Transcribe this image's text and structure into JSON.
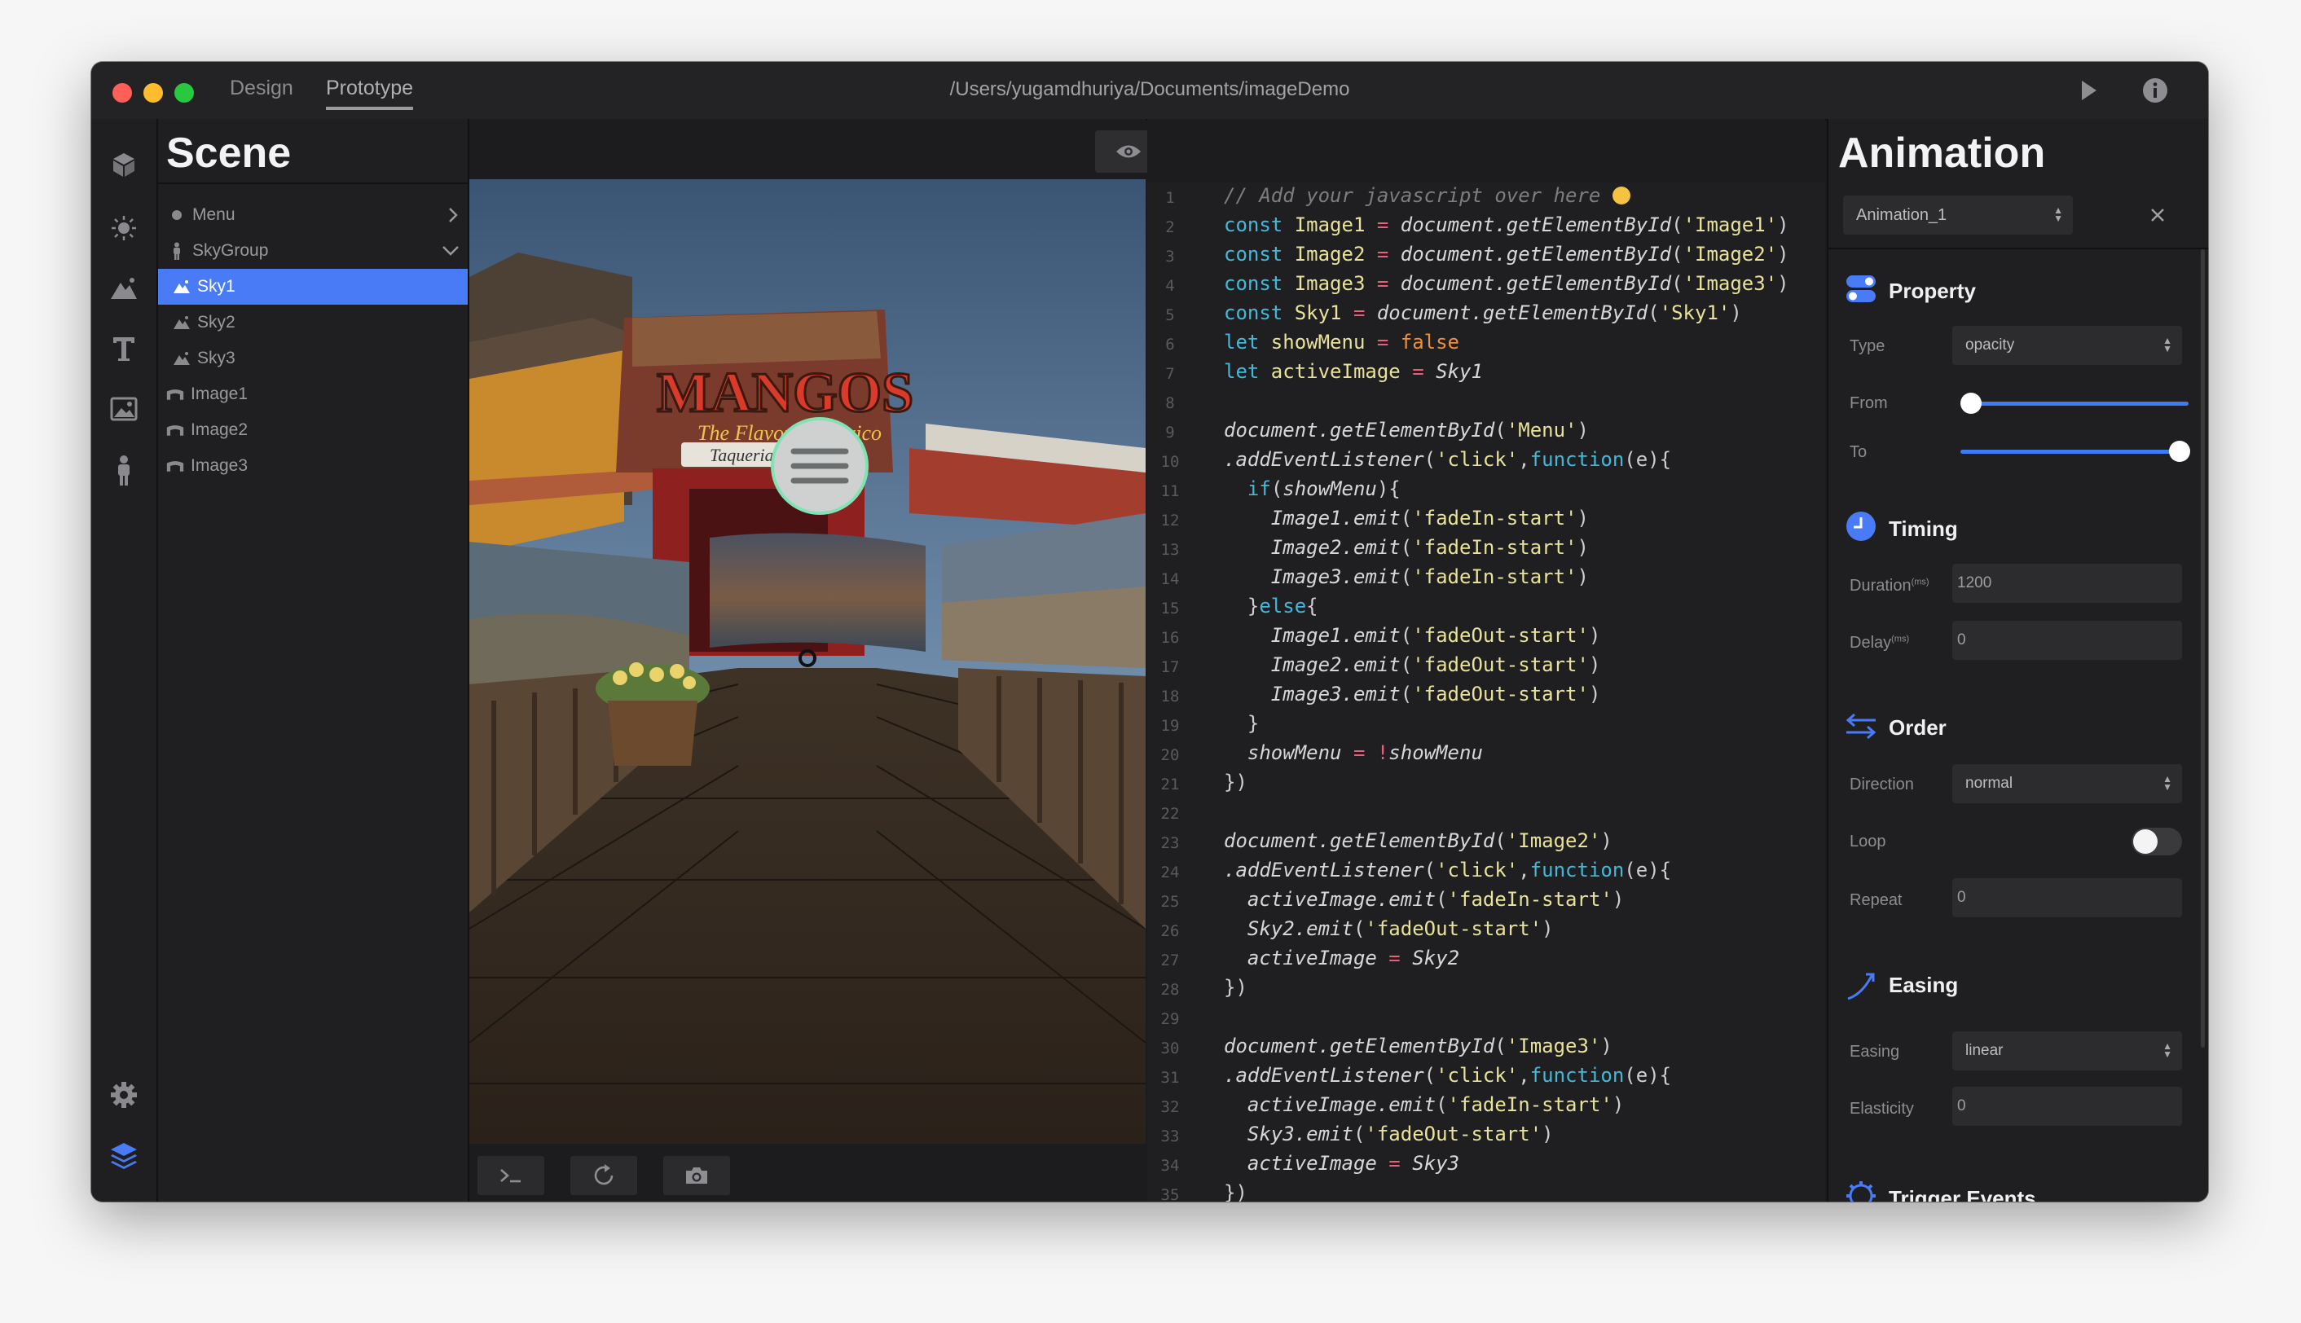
{
  "titlebar": {
    "tabs": [
      "Design",
      "Prototype"
    ],
    "active_tab": "Prototype",
    "path": "/Users/yugamdhuriya/Documents/imageDemo"
  },
  "rail": {
    "icons": [
      "cube-icon",
      "sun-icon",
      "mountain-icon",
      "text-icon",
      "image-icon",
      "person-icon",
      "settings-icon",
      "layers-icon"
    ]
  },
  "scene": {
    "title": "Scene",
    "items": [
      {
        "label": "Menu",
        "icon": "dot-icon",
        "arrow": "chevron-right"
      },
      {
        "label": "SkyGroup",
        "icon": "person-icon",
        "arrow": "chevron-down"
      },
      {
        "label": "Sky1",
        "icon": "mountain-icon",
        "selected": true
      },
      {
        "label": "Sky2",
        "icon": "mountain-icon"
      },
      {
        "label": "Sky3",
        "icon": "mountain-icon"
      },
      {
        "label": "Image1",
        "icon": "curved-image-icon"
      },
      {
        "label": "Image2",
        "icon": "curved-image-icon"
      },
      {
        "label": "Image3",
        "icon": "curved-image-icon"
      }
    ]
  },
  "viewport": {
    "toolbar": [
      "eye-icon",
      "eye-icon",
      "code-icon",
      "code-icon"
    ],
    "bottom": [
      "terminal-icon",
      "refresh-icon",
      "camera-icon"
    ],
    "scene_texts": {
      "sign": "MANGOS",
      "sign_sub": "The Flavor of Mexico",
      "sign_tag": "Taqueria"
    }
  },
  "editor": {
    "line_numbers": [
      "1",
      "2",
      "3",
      "4",
      "5",
      "6",
      "7",
      "8",
      "9",
      "10",
      "11",
      "12",
      "13",
      "14",
      "15",
      "16",
      "17",
      "18",
      "19",
      "20",
      "21",
      "22",
      "23",
      "24",
      "25",
      "26",
      "27",
      "28",
      "29",
      "30",
      "31",
      "32",
      "33",
      "34",
      "35"
    ]
  },
  "animation": {
    "title": "Animation",
    "selected": "Animation_1",
    "property": {
      "title": "Property",
      "type_label": "Type",
      "type": "opacity",
      "from_label": "From",
      "to_label": "To",
      "from": 0,
      "to": 1
    },
    "timing": {
      "title": "Timing",
      "duration_label": "Duration",
      "duration_unit": "(ms)",
      "duration": "1200",
      "delay_label": "Delay",
      "delay_unit": "(ms)",
      "delay": "0"
    },
    "order": {
      "title": "Order",
      "direction_label": "Direction",
      "direction": "normal",
      "loop_label": "Loop",
      "loop": false,
      "repeat_label": "Repeat",
      "repeat": "0"
    },
    "easing": {
      "title": "Easing",
      "easing_label": "Easing",
      "easing": "linear",
      "elasticity_label": "Elasticity",
      "elasticity": "0"
    },
    "trigger_title": "Trigger Events"
  },
  "colors": {
    "accent": "#3d7cf5",
    "panel": "#1f1f21",
    "selection": "#4a7bf6"
  }
}
